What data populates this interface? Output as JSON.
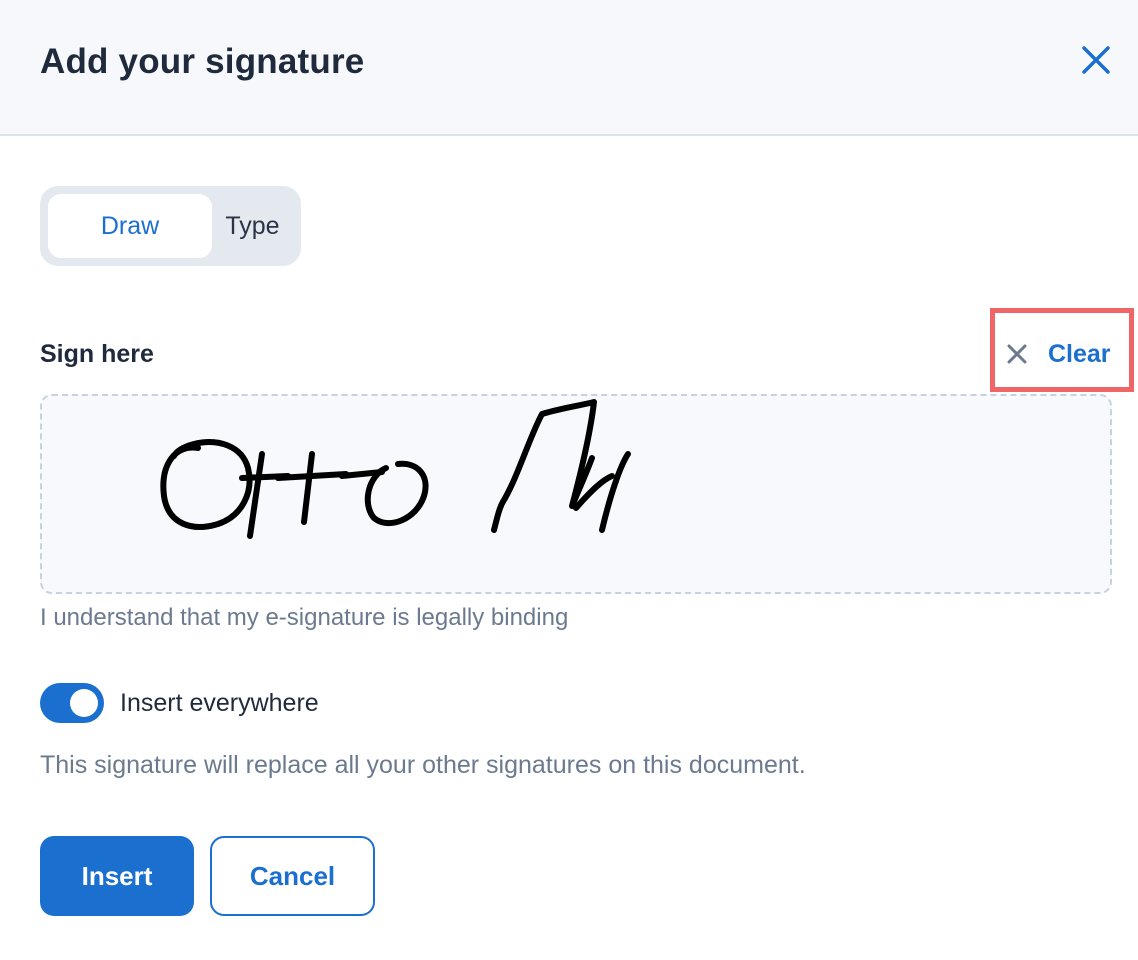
{
  "dialog": {
    "title": "Add your signature",
    "close_icon": "close-icon"
  },
  "mode_tabs": {
    "items": [
      {
        "label": "Draw",
        "selected": true
      },
      {
        "label": "Type",
        "selected": false
      }
    ]
  },
  "signature": {
    "label": "Sign here",
    "clear_label": "Clear",
    "clear_icon": "close-icon",
    "legal_text": "I understand that my e-signature is legally binding"
  },
  "insert_everywhere": {
    "label": "Insert everywhere",
    "enabled": true,
    "note": "This signature will replace all your other signatures on this document."
  },
  "actions": {
    "insert_label": "Insert",
    "cancel_label": "Cancel"
  },
  "colors": {
    "accent": "#1b6fcf",
    "highlight": "#f06565",
    "muted_text": "#6b7a8f"
  }
}
